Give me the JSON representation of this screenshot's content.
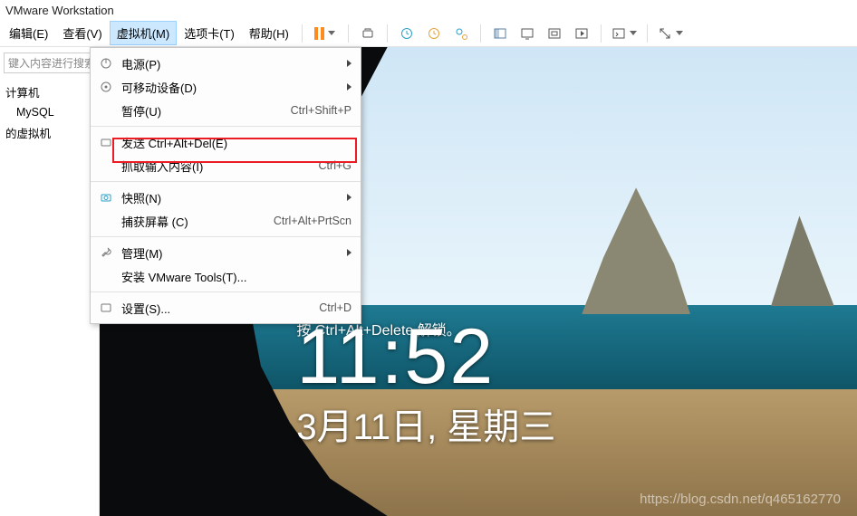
{
  "app": {
    "title": "VMware Workstation"
  },
  "menubar": {
    "edit": "编辑(E)",
    "view": "查看(V)",
    "vm": "虚拟机(M)",
    "tabs": "选项卡(T)",
    "help": "帮助(H)"
  },
  "sidebar": {
    "search_placeholder": "键入内容进行搜索",
    "items": [
      {
        "label": "计算机"
      },
      {
        "label": "MySQL"
      },
      {
        "label": "的虚拟机"
      }
    ]
  },
  "dropdown": {
    "power": {
      "label": "电源(P)"
    },
    "removable": {
      "label": "可移动设备(D)"
    },
    "pause": {
      "label": "暂停(U)",
      "accel": "Ctrl+Shift+P"
    },
    "send_cad": {
      "label": "发送 Ctrl+Alt+Del(E)"
    },
    "grab": {
      "label": "抓取输入内容(I)",
      "accel": "Ctrl+G"
    },
    "snapshot": {
      "label": "快照(N)"
    },
    "capture": {
      "label": "捕获屏幕 (C)",
      "accel": "Ctrl+Alt+PrtScn"
    },
    "manage": {
      "label": "管理(M)"
    },
    "tools": {
      "label": "安装 VMware Tools(T)..."
    },
    "settings": {
      "label": "设置(S)...",
      "accel": "Ctrl+D"
    }
  },
  "lockscreen": {
    "unlock": "按 Ctrl+Alt+Delete 解锁。",
    "time": "11:52",
    "date": "3月11日, 星期三"
  },
  "watermark": "https://blog.csdn.net/q465162770"
}
